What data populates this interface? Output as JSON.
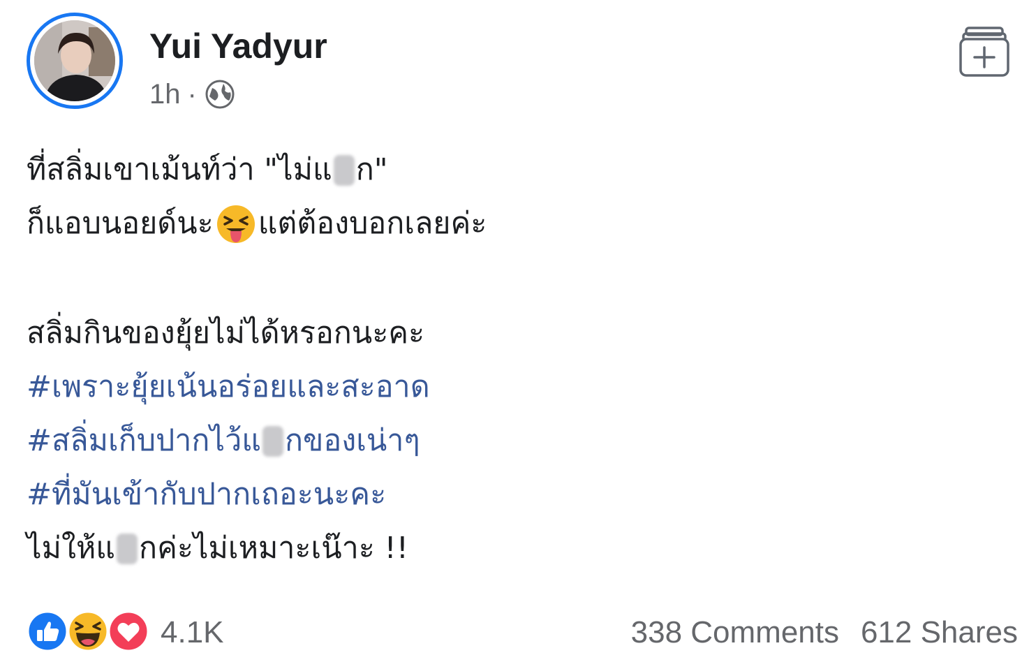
{
  "post": {
    "author": "Yui Yadyur",
    "time": "1h",
    "separator": "·",
    "privacy_icon": "globe-icon",
    "save_icon": "add-to-collection-icon"
  },
  "body": {
    "line1_a": "ที่สลิ่มเขาเม้นท์ว่า \"ไม่แ",
    "line1_b": "ก\"",
    "line2_a": "ก็แอบนอยด์นะ",
    "line2_emoji": "squinting-face-with-tongue-emoji",
    "line2_b": "แต่ต้องบอกเลยค่ะ",
    "line3": "สลิ่มกินของยุ้ยไม่ได้หรอกนะคะ",
    "hashtag1": "#เพราะยุ้ยเน้นอร่อยและสะอาด",
    "hashtag2_a": "#สลิ่มเก็บปากไว้แ",
    "hashtag2_b": "กของเน่าๆ",
    "hashtag3": "#ที่มันเข้ากับปากเถอะนะคะ",
    "line7_a": "ไม่ให้แ",
    "line7_b": "กค่ะไม่เหมาะเน๊าะ !!"
  },
  "engagement": {
    "reactions": [
      "like-icon",
      "haha-icon",
      "love-icon"
    ],
    "reaction_count": "4.1K",
    "comments": "338 Comments",
    "shares": "612 Shares"
  },
  "colors": {
    "accent": "#1877f2",
    "hashtag": "#385898",
    "meta": "#65676b",
    "text": "#1c1e21"
  }
}
